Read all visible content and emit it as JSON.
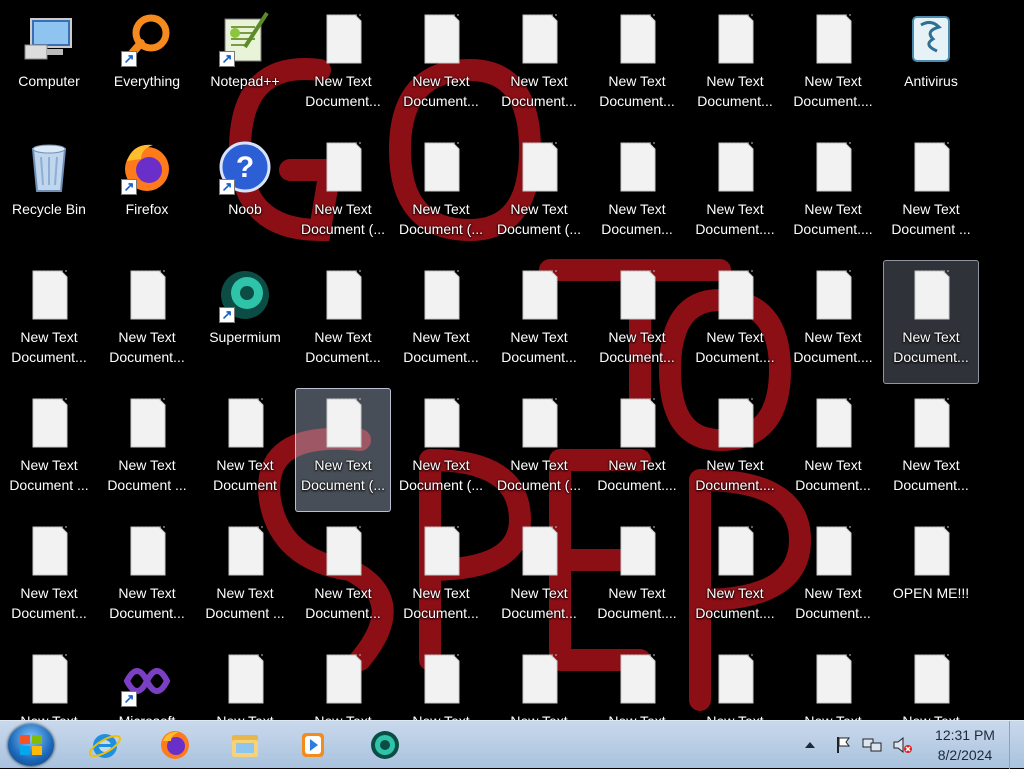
{
  "desktop": {
    "icons": [
      {
        "label": "Computer",
        "type": "computer",
        "shortcut": false
      },
      {
        "label": "Everything",
        "type": "everything",
        "shortcut": true
      },
      {
        "label": "Notepad++",
        "type": "notepadpp",
        "shortcut": true
      },
      {
        "label": "New Text\nDocument...",
        "type": "doc"
      },
      {
        "label": "New Text\nDocument...",
        "type": "doc"
      },
      {
        "label": "New Text\nDocument...",
        "type": "doc"
      },
      {
        "label": "New Text\nDocument...",
        "type": "doc"
      },
      {
        "label": "New Text\nDocument...",
        "type": "doc"
      },
      {
        "label": "New Text\nDocument....",
        "type": "doc"
      },
      {
        "label": "Antivirus",
        "type": "antivirus",
        "shortcut": false
      },
      {
        "label": "Recycle Bin",
        "type": "recycle",
        "shortcut": false
      },
      {
        "label": "Firefox",
        "type": "firefox",
        "shortcut": true
      },
      {
        "label": "Noob",
        "type": "noob",
        "shortcut": true
      },
      {
        "label": "New Text\nDocument (...",
        "type": "doc"
      },
      {
        "label": "New Text\nDocument (...",
        "type": "doc"
      },
      {
        "label": "New Text\nDocument (...",
        "type": "doc"
      },
      {
        "label": "New Text\nDocumen...",
        "type": "doc"
      },
      {
        "label": "New Text\nDocument....",
        "type": "doc"
      },
      {
        "label": "New Text\nDocument....",
        "type": "doc"
      },
      {
        "label": "New Text\nDocument ...",
        "type": "doc"
      },
      {
        "label": "New Text\nDocument...",
        "type": "doc"
      },
      {
        "label": "New Text\nDocument...",
        "type": "doc"
      },
      {
        "label": "Supermium",
        "type": "supermium",
        "shortcut": true
      },
      {
        "label": "New Text\nDocument...",
        "type": "doc"
      },
      {
        "label": "New Text\nDocument...",
        "type": "doc"
      },
      {
        "label": "New Text\nDocument...",
        "type": "doc"
      },
      {
        "label": "New Text\nDocument...",
        "type": "doc"
      },
      {
        "label": "New Text\nDocument....",
        "type": "doc"
      },
      {
        "label": "New Text\nDocument....",
        "type": "doc"
      },
      {
        "label": "New Text\nDocument...",
        "type": "doc",
        "state": "hover"
      },
      {
        "label": "New Text\nDocument ...",
        "type": "doc"
      },
      {
        "label": "New Text\nDocument ...",
        "type": "doc"
      },
      {
        "label": "New Text\nDocument",
        "type": "doc"
      },
      {
        "label": "New Text\nDocument (...",
        "type": "doc",
        "state": "selected"
      },
      {
        "label": "New Text\nDocument (...",
        "type": "doc"
      },
      {
        "label": "New Text\nDocument (...",
        "type": "doc"
      },
      {
        "label": "New Text\nDocument....",
        "type": "doc"
      },
      {
        "label": "New Text\nDocument....",
        "type": "doc"
      },
      {
        "label": "New Text\nDocument...",
        "type": "doc"
      },
      {
        "label": "New Text\nDocument...",
        "type": "doc"
      },
      {
        "label": "New Text\nDocument...",
        "type": "doc"
      },
      {
        "label": "New Text\nDocument...",
        "type": "doc"
      },
      {
        "label": "New Text\nDocument ...",
        "type": "doc"
      },
      {
        "label": "New Text\nDocument...",
        "type": "doc"
      },
      {
        "label": "New Text\nDocument...",
        "type": "doc"
      },
      {
        "label": "New Text\nDocument...",
        "type": "doc"
      },
      {
        "label": "New Text\nDocument....",
        "type": "doc"
      },
      {
        "label": "New Text\nDocument....",
        "type": "doc"
      },
      {
        "label": "New Text\nDocument...",
        "type": "doc"
      },
      {
        "label": "OPEN ME!!!",
        "type": "doc"
      },
      {
        "label": "New Text",
        "type": "doc"
      },
      {
        "label": "Microsoft",
        "type": "vs",
        "shortcut": true
      },
      {
        "label": "New Text",
        "type": "doc"
      },
      {
        "label": "New Text",
        "type": "doc"
      },
      {
        "label": "New Text",
        "type": "doc"
      },
      {
        "label": "New Text",
        "type": "doc"
      },
      {
        "label": "New Text",
        "type": "doc"
      },
      {
        "label": "New Text",
        "type": "doc"
      },
      {
        "label": "New Text",
        "type": "doc"
      },
      {
        "label": "New Text",
        "type": "doc"
      }
    ]
  },
  "wallpaper": {
    "text_color": "#b8141c"
  },
  "taskbar": {
    "start": {
      "icon": "windows-logo-icon"
    },
    "pinned": [
      {
        "name": "internet-explorer",
        "icon": "ie-icon"
      },
      {
        "name": "firefox",
        "icon": "firefox-icon"
      },
      {
        "name": "file-explorer",
        "icon": "folder-icon"
      },
      {
        "name": "media-player",
        "icon": "media-player-icon"
      },
      {
        "name": "supermium",
        "icon": "supermium-icon"
      }
    ],
    "tray": {
      "icons": [
        "show-hidden-icons-arrow",
        "action-center-flag-icon",
        "network-icon",
        "volume-muted-icon"
      ],
      "time": "12:31 PM",
      "date": "8/2/2024"
    }
  },
  "colors": {
    "taskbar": "#b9cde4",
    "desktop_bg": "#000000"
  }
}
